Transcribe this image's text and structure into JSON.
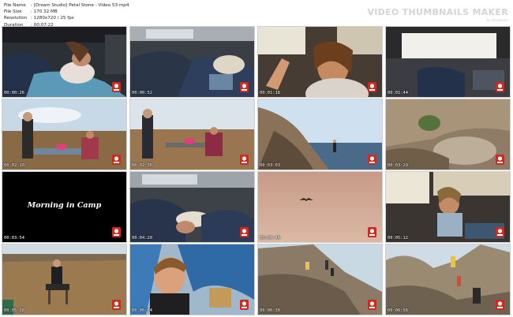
{
  "file_info": [
    {
      "label": "File Name",
      "value": ":  [Dream Studio] Petal Stone - Video 53.mp4"
    },
    {
      "label": "File Size",
      "value": ":  170.32 MB"
    },
    {
      "label": "Resolution",
      "value": ":  1280x720 / 25 fps"
    },
    {
      "label": "Duration",
      "value": ":  00:07:22"
    }
  ],
  "brand": {
    "title": "VIDEO THUMBNAILS MAKER",
    "subtitle": "by iDealshare"
  },
  "thumbnails": [
    {
      "timestamp": "00:00:26",
      "scene": "car-sleeping-bags-girl"
    },
    {
      "timestamp": "00:00:52",
      "scene": "car-sleeping-bag-blanket"
    },
    {
      "timestamp": "00:01:18",
      "scene": "car-girl-waving"
    },
    {
      "timestamp": "00:01:44",
      "scene": "car-window-morning"
    },
    {
      "timestamp": "00:02:10",
      "scene": "camp-table-people"
    },
    {
      "timestamp": "00:02:36",
      "scene": "camp-table-girl-standing"
    },
    {
      "timestamp": "00:03:03",
      "scene": "rocky-cliff-climbers"
    },
    {
      "timestamp": "00:03:29",
      "scene": "cliff-rocks-close"
    },
    {
      "timestamp": "00:03:54",
      "scene": "title-card",
      "caption": "Morning in Camp"
    },
    {
      "timestamp": "00:04:20",
      "scene": "car-sleeping-bags"
    },
    {
      "timestamp": "00:04:46",
      "scene": "sky-bird"
    },
    {
      "timestamp": "00:05:12",
      "scene": "car-girl-sitting"
    },
    {
      "timestamp": "00:05:38",
      "scene": "man-camp-chair"
    },
    {
      "timestamp": "00:06:04",
      "scene": "boy-tent-smiling"
    },
    {
      "timestamp": "00:06:30",
      "scene": "climbers-rock"
    },
    {
      "timestamp": "00:06:56",
      "scene": "rocks-people-standing"
    }
  ],
  "colors": {
    "timestamp": "#ffffff",
    "brand": "#d4d4d4",
    "logo_red": "#cc2a1e"
  }
}
